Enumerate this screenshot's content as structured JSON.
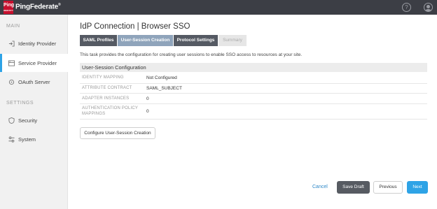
{
  "topbar": {
    "logo_text": "Ping",
    "logo_sub": "IDENTITY",
    "brand_name": "PingFederate",
    "brand_mark": "®",
    "help_icon": "question-circle-icon",
    "user_icon": "user-avatar-icon"
  },
  "sidebar": {
    "main_label": "MAIN",
    "settings_label": "SETTINGS",
    "items": [
      {
        "label": "Identity Provider",
        "icon": "sign-in-icon"
      },
      {
        "label": "Service Provider",
        "icon": "server-icon",
        "active": true
      },
      {
        "label": "OAuth Server",
        "icon": "oauth-icon"
      },
      {
        "label": "Security",
        "icon": "shield-icon"
      },
      {
        "label": "System",
        "icon": "sliders-icon"
      }
    ]
  },
  "main": {
    "title": "IdP Connection | Browser SSO",
    "tabs": [
      {
        "label": "SAML Profiles",
        "state": "done"
      },
      {
        "label": "User-Session Creation",
        "state": "current"
      },
      {
        "label": "Protocol Settings",
        "state": "done"
      },
      {
        "label": "Summary",
        "state": "future"
      }
    ],
    "description": "This task provides the configuration for creating user sessions to enable SSO access to resources at your site.",
    "section_title": "User-Session Configuration",
    "rows": [
      {
        "key": "IDENTITY MAPPING",
        "value": "Not Configured"
      },
      {
        "key": "ATTRIBUTE CONTRACT",
        "value": "SAML_SUBJECT"
      },
      {
        "key": "ADAPTER INSTANCES",
        "value": "0"
      },
      {
        "key": "AUTHENTICATION POLICY",
        "key2": "MAPPINGS",
        "value": "0"
      }
    ],
    "configure_button": "Configure User-Session Creation"
  },
  "footer": {
    "cancel": "Cancel",
    "save_draft": "Save Draft",
    "previous": "Previous",
    "next": "Next"
  },
  "colors": {
    "topbar": "#3c3e45",
    "accent": "#2ea3e6",
    "brand_red": "#c8102e",
    "tab_done": "#555a63",
    "tab_current": "#8fa4bb"
  }
}
